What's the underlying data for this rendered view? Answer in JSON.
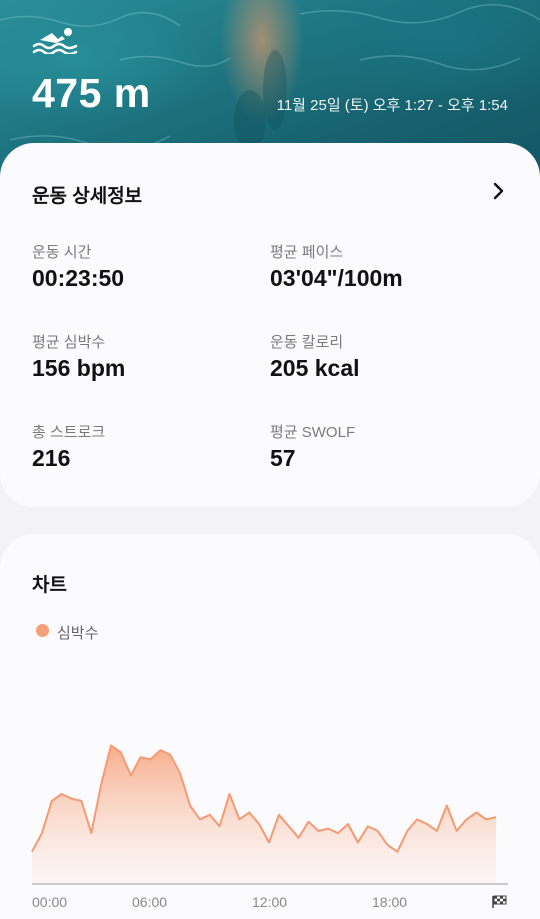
{
  "header": {
    "distance": "475 m",
    "datetime": "11월 25일 (토) 오후 1:27 - 오후 1:54",
    "icon": "swimmer-icon"
  },
  "details": {
    "title": "운동 상세정보",
    "stats": [
      {
        "label": "운동 시간",
        "value": "00:23:50"
      },
      {
        "label": "평균 페이스",
        "value": "03'04\"/100m"
      },
      {
        "label": "평균 심박수",
        "value": "156 bpm"
      },
      {
        "label": "운동 칼로리",
        "value": "205 kcal"
      },
      {
        "label": "총 스트로크",
        "value": "216"
      },
      {
        "label": "평균 SWOLF",
        "value": "57"
      }
    ]
  },
  "chart": {
    "title": "차트",
    "legend": "심박수",
    "color": "#f5a07a",
    "ticks": [
      "00:00",
      "06:00",
      "12:00",
      "18:00"
    ]
  },
  "chart_data": {
    "type": "area",
    "title": "차트",
    "xlabel": "",
    "ylabel": "",
    "x_ticks": [
      "00:00",
      "06:00",
      "12:00",
      "18:00"
    ],
    "series": [
      {
        "name": "심박수",
        "x": [
          0,
          0.5,
          1,
          1.5,
          2,
          2.5,
          3,
          3.5,
          4,
          4.5,
          5,
          5.5,
          6,
          6.5,
          7,
          7.5,
          8,
          8.5,
          9,
          9.5,
          10,
          10.5,
          11,
          11.5,
          12,
          12.5,
          13,
          13.5,
          14,
          14.5,
          15,
          15.5,
          16,
          16.5,
          17,
          17.5,
          18,
          18.5,
          19,
          19.5,
          20,
          20.5,
          21,
          21.5,
          22,
          22.5,
          23,
          23.5
        ],
        "values": [
          124,
          132,
          146,
          149,
          147,
          146,
          132,
          153,
          170,
          167,
          157,
          165,
          164,
          168,
          166,
          158,
          144,
          138,
          140,
          135,
          149,
          138,
          141,
          136,
          128,
          140,
          135,
          130,
          137,
          133,
          134,
          132,
          136,
          128,
          135,
          133,
          127,
          124,
          133,
          138,
          136,
          133,
          144,
          133,
          138,
          141,
          138,
          139
        ]
      }
    ]
  }
}
